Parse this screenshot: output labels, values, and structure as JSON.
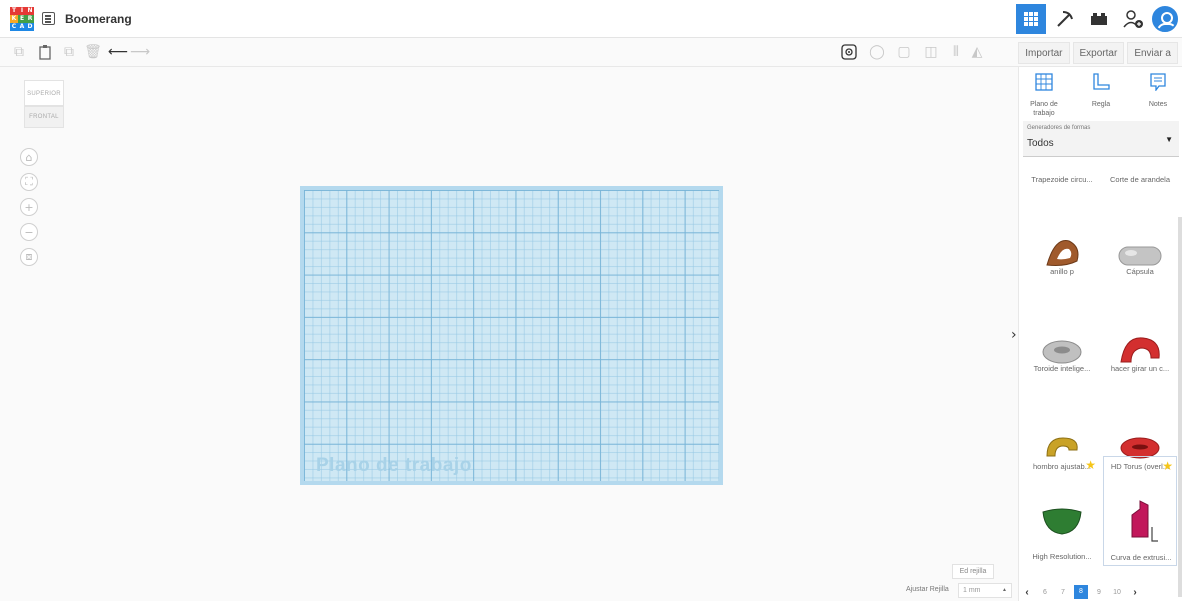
{
  "app": {
    "logo_letters": [
      "T",
      "I",
      "N",
      "K",
      "E",
      "R",
      "C",
      "A",
      "D"
    ],
    "project_title": "Boomerang"
  },
  "header_actions": {
    "import_label": "Importar",
    "export_label": "Exportar",
    "send_label": "Enviar a"
  },
  "viewcube": {
    "top_label": "SUPERIOR",
    "front_label": "FRONTAL"
  },
  "workplane": {
    "label": "Plano de trabajo"
  },
  "grid_controls": {
    "edit_grid_label": "Ed rejilla",
    "snap_label": "Ajustar Rejilla",
    "snap_value": "1 mm"
  },
  "panel": {
    "tools": [
      {
        "label": "Plano de trabajo",
        "icon": "workplane-icon"
      },
      {
        "label": "Regla",
        "icon": "ruler-icon"
      },
      {
        "label": "Notes",
        "icon": "notes-icon"
      }
    ],
    "generator": {
      "label": "Generadores de formas",
      "value": "Todos"
    },
    "shapes": [
      {
        "name": "Trapezoide circu...",
        "color": "#a05a2c"
      },
      {
        "name": "Corte de arandela",
        "color": "#b8b8b8"
      },
      {
        "name": "anillo p",
        "color": "#8a5a34"
      },
      {
        "name": "Cápsula",
        "color": "#b8b8b8"
      },
      {
        "name": "Toroide intelige...",
        "color": "#b3b3b3"
      },
      {
        "name": "hacer girar un c...",
        "color": "#d32f2f"
      },
      {
        "name": "hombro ajustab...",
        "color": "#c9a227"
      },
      {
        "name": "HD Torus (overl...",
        "color": "#d32f2f"
      },
      {
        "name": "High Resolution...",
        "color": "#2e7d32"
      },
      {
        "name": "Curva de extrusi...",
        "color": "#c2185b"
      }
    ],
    "pagination": {
      "pages": [
        "6",
        "7",
        "8",
        "9",
        "10"
      ],
      "current": "8"
    }
  }
}
